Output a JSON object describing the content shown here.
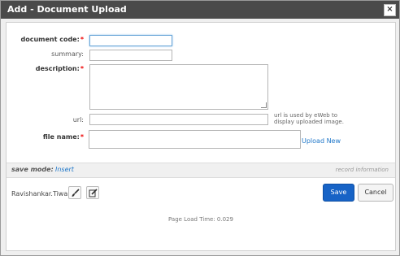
{
  "window": {
    "title": "Add - Document Upload",
    "close_glyph": "×"
  },
  "form": {
    "document_code": {
      "label": "document code:",
      "required_mark": "*",
      "value": ""
    },
    "summary": {
      "label": "summary:",
      "value": ""
    },
    "description": {
      "label": "description:",
      "required_mark": "*",
      "value": ""
    },
    "url": {
      "label": "url:",
      "value": "",
      "hint_line1": "url is used by eWeb to",
      "hint_line2": "display uploaded image."
    },
    "file_name": {
      "label": "file name:",
      "required_mark": "*",
      "value": "",
      "upload_link": "Upload New"
    }
  },
  "save_bar": {
    "label": "save mode:",
    "mode": "Insert",
    "record_info": "record information"
  },
  "user": {
    "name": "Ravishankar.Tiwari"
  },
  "buttons": {
    "save": "Save",
    "cancel": "Cancel"
  },
  "footer": {
    "load_time": "Page Load Time: 0.029"
  },
  "colors": {
    "accent": "#1763c6",
    "link": "#1f77c9",
    "required": "#e00000",
    "titlebar": "#4a4a4a"
  }
}
